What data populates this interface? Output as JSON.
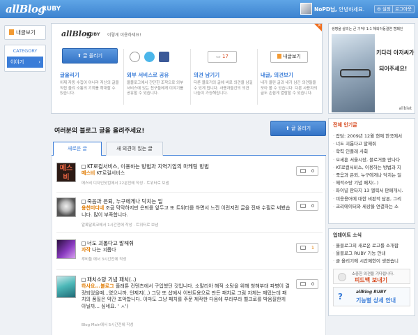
{
  "topbar": {
    "logo": "allBlog",
    "product": "RUBY",
    "username": "NoPD님,",
    "greeting_tail": "안녕하세요.",
    "settings_label": "설정",
    "logout_label": "로그아웃"
  },
  "leftnav": {
    "my_posts_label": "내글보기",
    "category_title": "CATEGORY",
    "category_item": "이야기",
    "chevron": "›"
  },
  "intro": {
    "logo": "allBlog",
    "product": "RUBY",
    "guide": "이렇게 이용하세요!",
    "columns": [
      {
        "button": "글 올리기",
        "heading": "글올리기",
        "desc": "이제 자동 수집이 아니라 저신의 글을 직접 올려 소통의 기회를 확대할 수 있습니다."
      },
      {
        "button": "",
        "heading": "외부 서비스로 공유",
        "desc": "올블로그에서 간단한 조작으로 외부 서비스에 있는 친구들에게 이야기를 공유할 수 있습니다."
      },
      {
        "button": "17",
        "heading": "의견 남기기",
        "desc": "다른 블로거의 글에 바로 의견을 남길 수 있게 됩니다. 사용자들간의 의견 나눔이 가능해집니다."
      },
      {
        "button": "내글보기",
        "heading": "내글, 의견보기",
        "desc": "내가 올린 글과 내가 남긴 의견들을 모아 볼 수 있습니다. 다른 사용자의 글도 손쉽게 열람할 수 있습니다."
      }
    ]
  },
  "feed": {
    "section_title": "여러분의 블로그 글을 올려주세요!",
    "post_button": "글 올리기",
    "tabs": [
      "새로운 글",
      "새 의견이 있는 글"
    ],
    "posts": [
      {
        "title": "KT로컬서비스, 이용하는 방법과 지역기업의 마케팅 방법",
        "author": "메스비",
        "excerpt": "KT로컬서비스",
        "meta": "메스비 디자인닷컴에서 22분전에 작성 · 트위터로 보냄",
        "comments": "0",
        "thumb": "메스비"
      },
      {
        "title": "죽음과 은퇴, 누구에게나 닥치는 일",
        "author": "용천미디네",
        "excerpt": "조금 막막하지만 은퇴를 앞두고 또 트위터를 하면서 느낀 이런저런 글을 진짜 수필로 써봤습니다. 많이 부족합니다.",
        "meta": "알록달록코에서 1시간전에 작성 · 트위터로 보냄",
        "comments": "0",
        "thumb": ""
      },
      {
        "title": "너도 괴롭다고 말해줘",
        "author": "자작",
        "excerpt": "나는 괴롭다",
        "meta": "루비들 에서 3시간전에 작성",
        "comments": "1",
        "thumb": ""
      },
      {
        "title": "패치소망 기념 패치(..)",
        "author": "하사요...블로그",
        "excerpt": "플래툰 컨텐츠에서 구입했던 것입니다. 소말리아 해적 소탕을 위해 청해부대 파병이 결정되었을때...였으니까. 언제지(..) 그당 또 샵에서 이번트용으로 만든 패치로 그림 자체는 재밌는데 패치의 품질은 약간 조악합니다. 이마도 그냥 패치를 주문 제작한 다음에 부라부라 벨크로를 박음질한게 아닐까... 싶네요. ' ㅅ')",
        "meta": "Blog Main에서 5시간전에 작성",
        "comments": "0",
        "thumb": ""
      }
    ]
  },
  "ad": {
    "top": "생명을 살리는 큰 기적! 1:1 해외아동결연 캠페인",
    "line1": "키다리 아저씨가",
    "line2": "되어주세요!",
    "brand": "allblet"
  },
  "popular": {
    "title": "전체 인기글",
    "items": [
      "잡담: 2009년 12월 현재 한국에서",
      "너도 괴롭다고 말해줘",
      "학력 인플레 사회",
      "오세훈 서울시장, 블로거를 만나다",
      "KT로컬서비스, 이용하는 방법과 지",
      "죽음과 은퇴, 누구에게나 닥치는 일",
      "해적소탕 기념 패치(..)",
      "파이널 판타지 13 엘릭서 판매개시.",
      "미용용어에 대한 비판적 담론, 그리",
      "크리에이터와 세상을 연결하는 소"
    ]
  },
  "news": {
    "title": "업데이트 소식",
    "items": [
      "올블로그의 새로운 로고를 소개합",
      "올블로그 RUBY 기능 안내",
      "글 올리기에 시간제한이 생겼습니"
    ],
    "banner1_small": "소중한 의견을 기다립니다.",
    "banner1_big": "피드백 보내기",
    "banner2_logo": "allBlog RUBY",
    "banner2_text": "기능별 상세 안내"
  },
  "colors": {
    "accent": "#3b7dd8",
    "orange": "#e07a00",
    "red": "#d64a1f"
  }
}
